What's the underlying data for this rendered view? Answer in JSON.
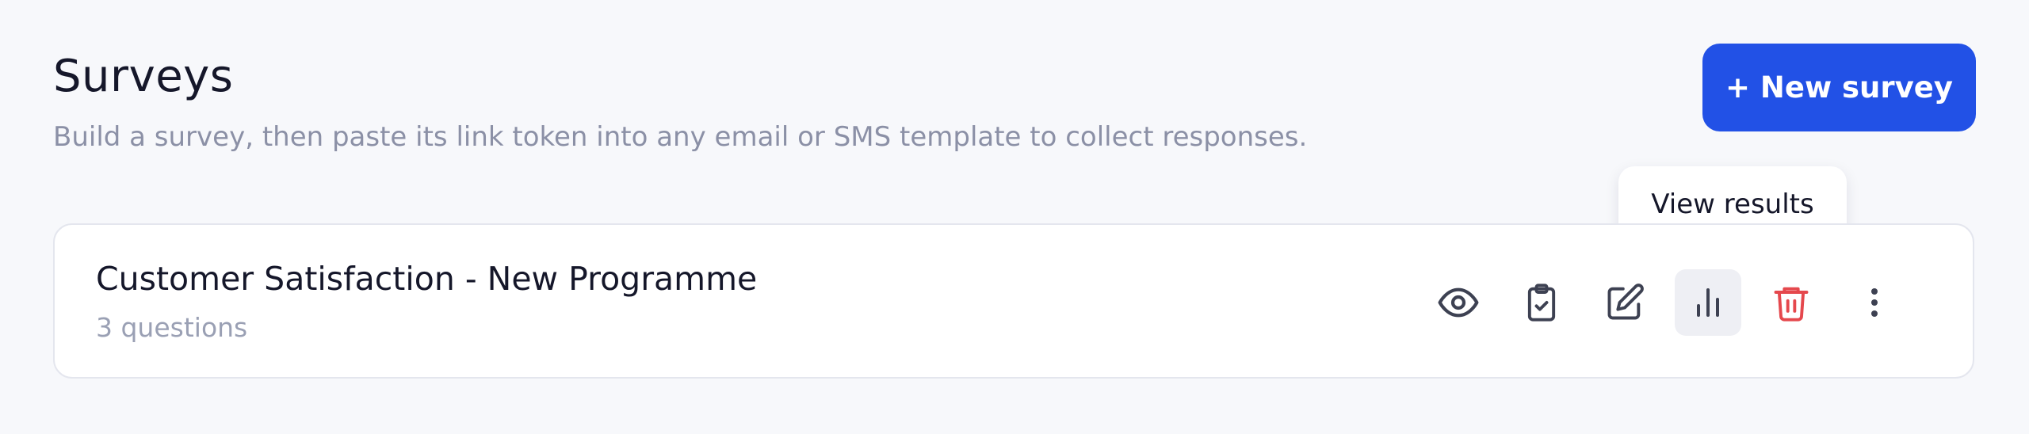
{
  "header": {
    "title": "Surveys",
    "subtitle": "Build a survey, then paste its link token into any email or SMS template to collect responses.",
    "new_button_label": "+ New survey"
  },
  "tooltip": {
    "text": "View results"
  },
  "surveys": [
    {
      "title": "Customer Satisfaction - New Programme",
      "meta": "3 questions",
      "actions": [
        {
          "name": "preview",
          "icon": "eye-icon"
        },
        {
          "name": "copy-link",
          "icon": "clipboard-check-icon"
        },
        {
          "name": "edit",
          "icon": "pencil-square-icon"
        },
        {
          "name": "view-results",
          "icon": "bar-chart-icon",
          "active": true
        },
        {
          "name": "delete",
          "icon": "trash-icon"
        },
        {
          "name": "more",
          "icon": "more-vertical-icon"
        }
      ]
    }
  ],
  "colors": {
    "background": "#f7f8fb",
    "primary": "#2251e6",
    "danger": "#e5484d",
    "icon": "#3d4152",
    "muted_text": "#8b90a6"
  }
}
